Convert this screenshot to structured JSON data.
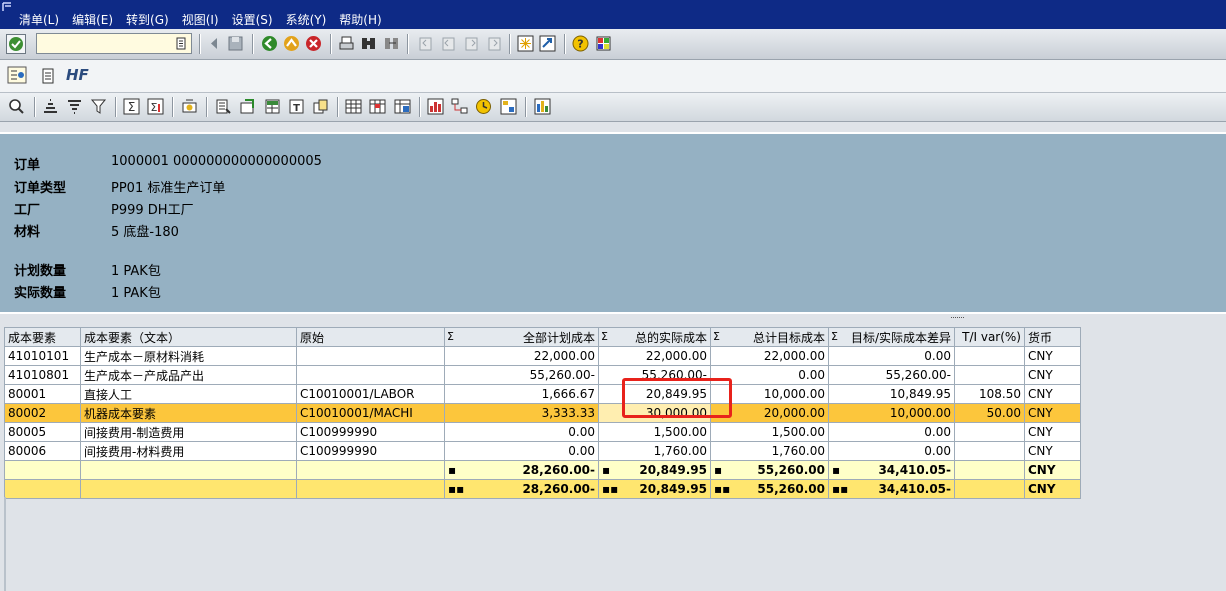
{
  "menu": {
    "items": [
      "清单(L)",
      "编辑(E)",
      "转到(G)",
      "视图(I)",
      "设置(S)",
      "系统(Y)",
      "帮助(H)"
    ]
  },
  "toolbar": {
    "command_value": "",
    "icons": [
      "check-icon",
      "back-icon",
      "save-icon",
      "enter-icon",
      "exit-icon",
      "cancel-icon",
      "print-icon",
      "find-icon",
      "find-next-icon",
      "first-page-icon",
      "prev-page-icon",
      "next-page-icon",
      "last-page-icon",
      "new-session-icon",
      "shortcut-icon",
      "help-icon",
      "layout-icon"
    ]
  },
  "title": {
    "text": "HF"
  },
  "header": {
    "rows": [
      {
        "label": "订单",
        "value": "1000001 000000000000000005"
      },
      {
        "label": "订单类型",
        "value": "PP01 标准生产订单"
      },
      {
        "label": "工厂",
        "value": "P999 DH工厂"
      },
      {
        "label": "材料",
        "value": "5 底盘-180"
      },
      {
        "label": "计划数量",
        "value": "1 PAK包"
      },
      {
        "label": "实际数量",
        "value": "1 PAK包"
      }
    ]
  },
  "grid": {
    "sigma": "Σ",
    "columns": [
      "成本要素",
      "成本要素（文本）",
      "原始",
      "全部计划成本",
      "总的实际成本",
      "总计目标成本",
      "目标/实际成本差异",
      "T/I var(%)",
      "货币"
    ],
    "rows": [
      [
        "41010101",
        "生产成本－原材料消耗",
        "",
        "22,000.00",
        "22,000.00",
        "22,000.00",
        "0.00",
        "",
        "CNY"
      ],
      [
        "41010801",
        "生产成本－产成品产出",
        "",
        "55,260.00-",
        "55,260.00-",
        "0.00",
        "55,260.00-",
        "",
        "CNY"
      ],
      [
        "80001",
        "直接人工",
        "C10010001/LABOR",
        "1,666.67",
        "20,849.95",
        "10,000.00",
        "10,849.95",
        "108.50",
        "CNY"
      ],
      [
        "80002",
        "机器成本要素",
        "C10010001/MACHI",
        "3,333.33",
        "30,000.00",
        "20,000.00",
        "10,000.00",
        "50.00",
        "CNY"
      ],
      [
        "80005",
        "间接费用-制造费用",
        "C100999990",
        "0.00",
        "1,500.00",
        "1,500.00",
        "0.00",
        "",
        "CNY"
      ],
      [
        "80006",
        "间接费用-材料费用",
        "C100999990",
        "0.00",
        "1,760.00",
        "1,760.00",
        "0.00",
        "",
        "CNY"
      ]
    ],
    "totals": [
      {
        "dots": "▪",
        "plan": "28,260.00-",
        "actual": "20,849.95",
        "target": "55,260.00",
        "variance": "34,410.05-",
        "currency": "CNY"
      },
      {
        "dots": "▪▪",
        "plan": "28,260.00-",
        "actual": "20,849.95",
        "target": "55,260.00",
        "variance": "34,410.05-",
        "currency": "CNY"
      }
    ]
  },
  "colors": {
    "menubar": "#0e2a86",
    "header_panel": "#95b1c3",
    "selected_row": "#fcc63c",
    "highlight_box": "#e8221b"
  }
}
